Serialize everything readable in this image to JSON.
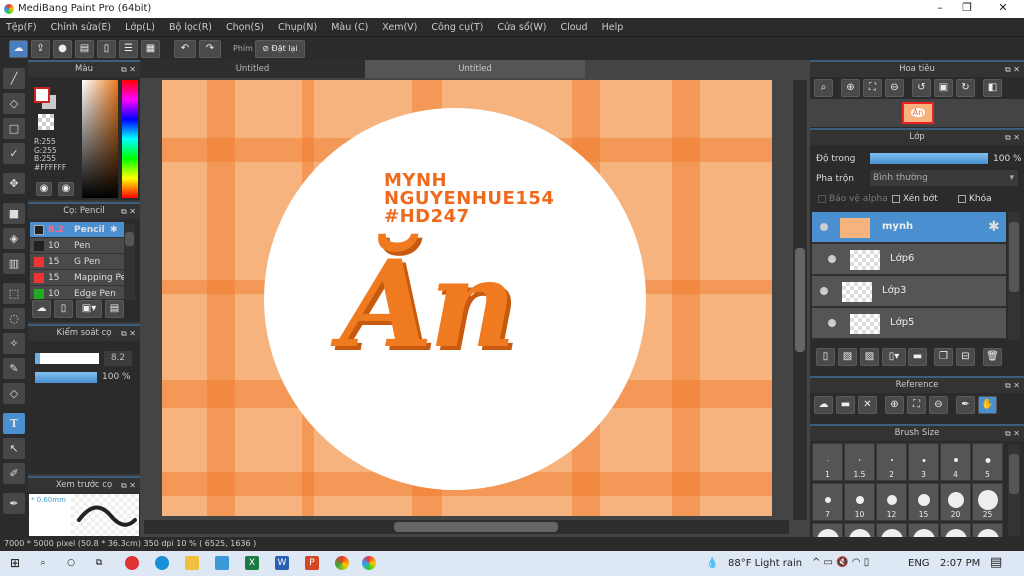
{
  "window": {
    "title": "MediBang Paint Pro (64bit)",
    "minimize": "–",
    "maximize": "❐",
    "close": "✕"
  },
  "menu": [
    "Tệp(F)",
    "Chỉnh sửa(E)",
    "Lớp(L)",
    "Bộ lọc(R)",
    "Chọn(S)",
    "Chụp(N)",
    "Màu (C)",
    "Xem(V)",
    "Công cụ(T)",
    "Cửa sổ(W)",
    "Cloud",
    "Help"
  ],
  "toolbar": {
    "shortcut_label": "Phím",
    "reset_label": "Đặt lại"
  },
  "color_panel": {
    "title": "Màu",
    "r": "R:255",
    "g": "G:255",
    "b": "B:255",
    "hex": "#FFFFFF"
  },
  "brush_panel": {
    "title": "Cọ: Pencil",
    "items": [
      {
        "size": "8.2",
        "name": "Pencil",
        "color": "#222222",
        "selected": true
      },
      {
        "size": "10",
        "name": "Pen",
        "color": "#222222"
      },
      {
        "size": "15",
        "name": "G Pen",
        "color": "#e33333"
      },
      {
        "size": "15",
        "name": "Mapping Pen",
        "color": "#e33333"
      },
      {
        "size": "10",
        "name": "Edge Pen",
        "color": "#22aa22"
      }
    ]
  },
  "brush_control": {
    "title": "Kiểm soát cọ",
    "size": "8.2",
    "opacity": "100 %",
    "size_fraction": 0.08,
    "opacity_fraction": 1.0
  },
  "brush_preview": {
    "title": "Xem trước cọ",
    "size": "* 0.60mm"
  },
  "tabs": [
    "Untitled",
    "Untitled"
  ],
  "canvas": {
    "lines": [
      "MYNH",
      "NGUYENHUE154",
      "#HD247"
    ],
    "big_text": "Ăn",
    "colors": {
      "orange": "#f06a1e",
      "bg": "#f6b37e"
    }
  },
  "navigator": {
    "title": "Hoa tiêu"
  },
  "layers": {
    "title": "Lớp",
    "opacity_label": "Độ trong",
    "opacity": "100 %",
    "blend_label": "Pha trộn",
    "blend": "Bình thường",
    "protect_alpha": "Bảo vệ alpha",
    "clip": "Xén bớt",
    "lock": "Khóa",
    "items": [
      {
        "name": "mynh",
        "selected": true
      },
      {
        "name": "Lớp6"
      },
      {
        "name": "Lớp3"
      },
      {
        "name": "Lớp5"
      }
    ]
  },
  "reference": {
    "title": "Reference"
  },
  "brush_size": {
    "title": "Brush Size",
    "sizes": [
      "1",
      "1.5",
      "2",
      "3",
      "4",
      "5",
      "7",
      "10",
      "12",
      "15",
      "20",
      "25"
    ]
  },
  "status": "7000 * 5000 pixel   (50.8 * 36.3cm)   350 dpi   10 %   ( 6525, 1636 )",
  "taskbar": {
    "weather": "88°F  Light rain",
    "lang": "ENG",
    "time": "2:07 PM"
  }
}
